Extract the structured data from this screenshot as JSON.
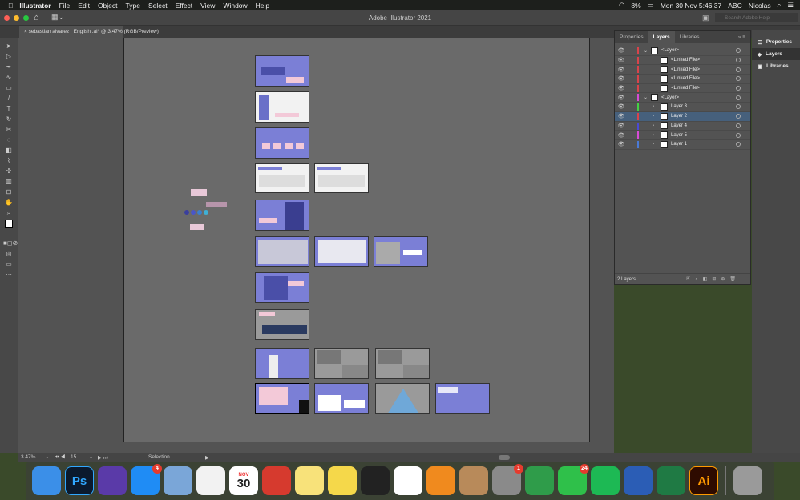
{
  "menubar": {
    "app": "Illustrator",
    "items": [
      "File",
      "Edit",
      "Object",
      "Type",
      "Select",
      "Effect",
      "View",
      "Window",
      "Help"
    ],
    "battery": "8%",
    "datetime": "Mon 30 Nov  5:46:37",
    "input_source": "ABC",
    "user": "Nicolas"
  },
  "toolbar": {
    "title": "Adobe Illustrator 2021",
    "search_placeholder": "Search Adobe Help"
  },
  "document_tab": {
    "title": "sebastian alvarez_ English .ai* @ 3.47% (RGB/Preview)"
  },
  "layers_panel": {
    "tabs": [
      "Properties",
      "Layers",
      "Libraries"
    ],
    "active_tab": "Layers",
    "rows": [
      {
        "name": "<Layer>",
        "color": "#d9434b",
        "level": 0,
        "expanded": true
      },
      {
        "name": "<Linked File>",
        "color": "#d9434b",
        "level": 1
      },
      {
        "name": "<Linked File>",
        "color": "#d9434b",
        "level": 1
      },
      {
        "name": "<Linked File>",
        "color": "#d9434b",
        "level": 1
      },
      {
        "name": "<Linked File>",
        "color": "#d9434b",
        "level": 1
      },
      {
        "name": "<Layer>",
        "color": "#d64bd6",
        "level": 0,
        "expanded": true
      },
      {
        "name": "Layer 3",
        "color": "#43d143",
        "level": 1
      },
      {
        "name": "Layer 2",
        "color": "#d9434b",
        "level": 1,
        "selected": true
      },
      {
        "name": "Layer 4",
        "color": "#4a4ad6",
        "level": 1
      },
      {
        "name": "Layer 5",
        "color": "#d64bd6",
        "level": 1
      },
      {
        "name": "Layer 1",
        "color": "#4a7ad6",
        "level": 1
      }
    ],
    "footer": "2 Layers"
  },
  "right_panel": {
    "items": [
      "Properties",
      "Layers",
      "Libraries"
    ],
    "active": "Layers"
  },
  "statusbar": {
    "zoom": "3.47%",
    "artboard": "15",
    "tool": "Selection"
  },
  "dock": {
    "apps": [
      {
        "name": "Finder",
        "color": "#3b8fe8"
      },
      {
        "name": "Photoshop",
        "label": "Ps",
        "color": "#0b1a2e"
      },
      {
        "name": "Siri",
        "color": "#5a3aa8"
      },
      {
        "name": "App Store",
        "color": "#1f8cf5",
        "badge": "4"
      },
      {
        "name": "Mail",
        "color": "#7aa6d8"
      },
      {
        "name": "Photos",
        "color": "#f2f2f2"
      },
      {
        "name": "Calendar",
        "month": "NOV",
        "day": "30",
        "color": "#ffffff"
      },
      {
        "name": "Popcorn Time",
        "color": "#d63a2e"
      },
      {
        "name": "Notes",
        "color": "#f8e27a"
      },
      {
        "name": "Stickies",
        "color": "#f5d84a"
      },
      {
        "name": "Aperture",
        "color": "#222222"
      },
      {
        "name": "Chrome",
        "color": "#ffffff"
      },
      {
        "name": "Books",
        "color": "#f08a1e"
      },
      {
        "name": "Contacts",
        "color": "#b88a5a"
      },
      {
        "name": "System Preferences",
        "color": "#8a8a8a",
        "badge": "1"
      },
      {
        "name": "Numbers",
        "color": "#2f9c4a"
      },
      {
        "name": "WhatsApp",
        "color": "#2fc04a",
        "badge": "24"
      },
      {
        "name": "Spotify",
        "color": "#1db954"
      },
      {
        "name": "Word",
        "color": "#2b5db5"
      },
      {
        "name": "Excel",
        "color": "#1f7a44"
      },
      {
        "name": "Illustrator",
        "label": "Ai",
        "color": "#2e0b00"
      },
      {
        "name": "Trash",
        "color": "#9a9a9a"
      }
    ]
  }
}
